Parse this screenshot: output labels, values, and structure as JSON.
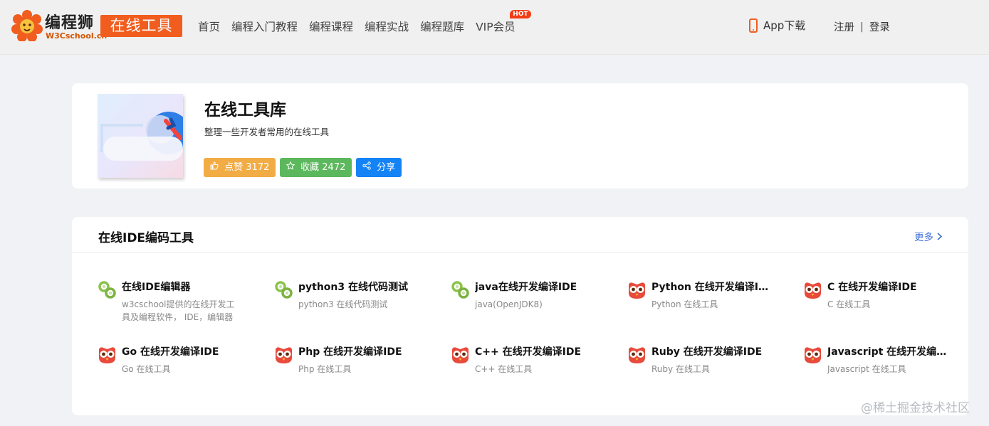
{
  "header": {
    "brand_cn": "编程狮",
    "brand_en": "W3Cschool.cn",
    "tool_badge": "在线工具",
    "nav": [
      {
        "label": "首页"
      },
      {
        "label": "编程入门教程"
      },
      {
        "label": "编程课程"
      },
      {
        "label": "编程实战"
      },
      {
        "label": "编程题库"
      },
      {
        "label": "VIP会员",
        "badge": "HOT"
      }
    ],
    "app_download": "App下载",
    "register": "注册",
    "separator": "|",
    "login": "登录"
  },
  "info": {
    "title": "在线工具库",
    "subtitle": "整理一些开发者常用的在线工具",
    "like_label": "点赞 3172",
    "fav_label": "收藏 2472",
    "share_label": "分享"
  },
  "section": {
    "title": "在线IDE编码工具",
    "more": "更多"
  },
  "tools": [
    {
      "name": "在线IDE编辑器",
      "desc": "w3cschool提供的在线开发工具及编程软件， IDE，编辑器等",
      "icon": "link-icon"
    },
    {
      "name": "python3 在线代码测试",
      "desc": "python3 在线代码测试",
      "icon": "link-icon"
    },
    {
      "name": "java在线开发编译IDE",
      "desc": "java(OpenJDK8)",
      "icon": "link-icon"
    },
    {
      "name": "Python 在线开发编译IDE",
      "desc": "Python 在线工具",
      "icon": "owl-icon"
    },
    {
      "name": "C 在线开发编译IDE",
      "desc": "C 在线工具",
      "icon": "owl-icon"
    },
    {
      "name": "Go 在线开发编译IDE",
      "desc": "Go 在线工具",
      "icon": "owl-icon"
    },
    {
      "name": "Php 在线开发编译IDE",
      "desc": "Php 在线工具",
      "icon": "owl-icon"
    },
    {
      "name": "C++ 在线开发编译IDE",
      "desc": "C++ 在线工具",
      "icon": "owl-icon"
    },
    {
      "name": "Ruby 在线开发编译IDE",
      "desc": "Ruby 在线工具",
      "icon": "owl-icon"
    },
    {
      "name": "Javascript 在线开发编译IDE",
      "desc": "Javascript 在线工具",
      "icon": "owl-icon"
    }
  ],
  "watermark": "@稀土掘金技术社区",
  "colors": {
    "brand_orange": "#f05d1f",
    "like": "#f2ac45",
    "favorite": "#5cb85c",
    "share": "#1483f6",
    "more_link": "#3d6fd6",
    "owl_red": "#e84a3c"
  }
}
